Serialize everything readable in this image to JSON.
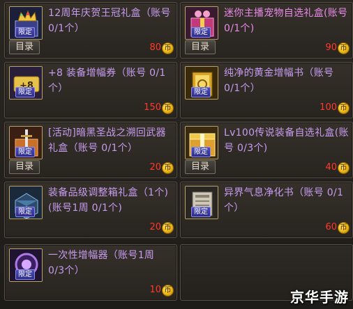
{
  "items": [
    {
      "title": "12周年庆贺王冠礼盒（账号 0/1个）",
      "badge": "限定",
      "menu": "目录",
      "price": "80",
      "coin": "币",
      "title_color": "#c79cf0",
      "icon": "crown-gift-box-icon"
    },
    {
      "title": "迷你主播宠物自选礼盒(账号 0/1个)",
      "badge": "限定",
      "menu": "目录",
      "price": "90",
      "coin": "币",
      "title_color": "#e98ae8",
      "icon": "pet-gift-box-icon"
    },
    {
      "title": "+8 装备增幅券（账号 0/1个）",
      "badge": "限定",
      "price": "150",
      "coin": "币",
      "title_color": "#c79cf0",
      "icon": "amplify-ticket-icon"
    },
    {
      "title": "纯净的黄金增幅书（账号 0/1个）",
      "badge": "限定",
      "price": "100",
      "coin": "币",
      "title_color": "#c79cf0",
      "icon": "gold-amplify-book-icon"
    },
    {
      "title": "[活动]暗黑圣战之溯回武器礼盒（账号 0/1个）",
      "badge": "限定",
      "menu": "目录",
      "price": "20",
      "coin": "币",
      "title_color": "#c79cf0",
      "icon": "weapon-gift-box-icon"
    },
    {
      "title": "Lv100传说装备自选礼盒(账号 0/3个)",
      "badge": "限定",
      "menu": "目录",
      "price": "40",
      "coin": "币",
      "title_color": "#c79cf0",
      "icon": "legendary-gift-box-icon"
    },
    {
      "title": "装备品级调整箱礼盒（1个)(账号1周 0/1个)",
      "badge": "限定",
      "price": "20",
      "coin": "币",
      "title_color": "#c79cf0",
      "icon": "grade-box-icon"
    },
    {
      "title": "异界气息净化书（账号 0/1个）",
      "badge": "限定",
      "price": "60",
      "coin": "币",
      "title_color": "#c79cf0",
      "icon": "purify-book-icon"
    },
    {
      "title": "一次性增幅器（账号1周 0/3个）",
      "badge": "限定",
      "price": "10",
      "coin": "币",
      "title_color": "#c79cf0",
      "icon": "amplifier-icon"
    }
  ],
  "watermark": "京华手游"
}
